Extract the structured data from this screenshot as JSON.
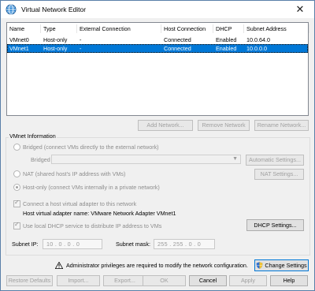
{
  "window": {
    "title": "Virtual Network Editor",
    "close_glyph": "✕",
    "icon": "network-globe-icon"
  },
  "table": {
    "headers": [
      "Name",
      "Type",
      "External Connection",
      "Host Connection",
      "DHCP",
      "Subnet Address"
    ],
    "rows": [
      [
        "VMnet0",
        "Host-only",
        "-",
        "Connected",
        "Enabled",
        "10.0.64.0"
      ],
      [
        "VMnet1",
        "Host-only",
        "-",
        "Connected",
        "Enabled",
        "10.0.0.0"
      ]
    ],
    "selected_row": 1
  },
  "list_buttons": {
    "add": "Add Network...",
    "remove": "Remove Network",
    "rename": "Rename Network..."
  },
  "vmnet_info": {
    "legend": "VMnet Information",
    "bridged": "Bridged (connect VMs directly to the external network)",
    "bridged_to_label": "Bridged to:",
    "bridged_to_value": "",
    "automatic_settings": "Automatic Settings...",
    "nat": "NAT (shared host's IP address with VMs)",
    "nat_settings": "NAT Settings...",
    "host_only": "Host-only (connect VMs internally in a private network)",
    "connect_adapter": "Connect a host virtual adapter to this network",
    "adapter_name": "Host virtual adapter name: VMware Network Adapter VMnet1",
    "use_dhcp": "Use local DHCP service to distribute IP address to VMs",
    "dhcp_settings": "DHCP Settings...",
    "subnet_ip_label": "Subnet IP:",
    "subnet_ip_value": "10 . 0 . 0 . 0",
    "subnet_mask_label": "Subnet mask:",
    "subnet_mask_value": "255 . 255 . 0 . 0"
  },
  "admin": {
    "message": "Administrator privileges are required to modify the network configuration.",
    "change_settings": "Change Settings"
  },
  "bottom_buttons": {
    "restore": "Restore Defaults",
    "import": "Import...",
    "export": "Export...",
    "ok": "OK",
    "cancel": "Cancel",
    "apply": "Apply",
    "help": "Help"
  },
  "colors": {
    "selection": "#0078d7",
    "title_bg": "#ffffff",
    "dialog_bg": "#f0f0f0"
  }
}
